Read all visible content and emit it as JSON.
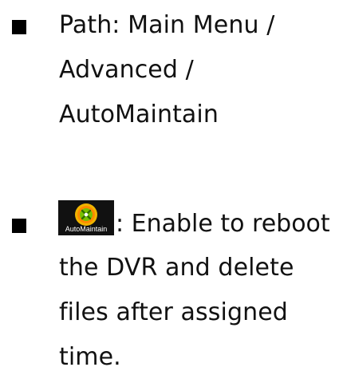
{
  "items": [
    {
      "lines": [
        "Path: Main Menu /",
        "Advanced /",
        "AutoMaintain"
      ]
    },
    {
      "icon": {
        "name": "auto-maintain-icon",
        "caption": "AutoMaintain"
      },
      "first_line": ": Enable to reboot",
      "lines": [
        "the DVR and delete",
        "files after assigned",
        "time."
      ]
    }
  ],
  "colors": {
    "bullet": "#000000",
    "text": "#111111",
    "icon_bg": "#111111",
    "icon_ring": "#f0b400",
    "icon_center": "#79c000"
  }
}
